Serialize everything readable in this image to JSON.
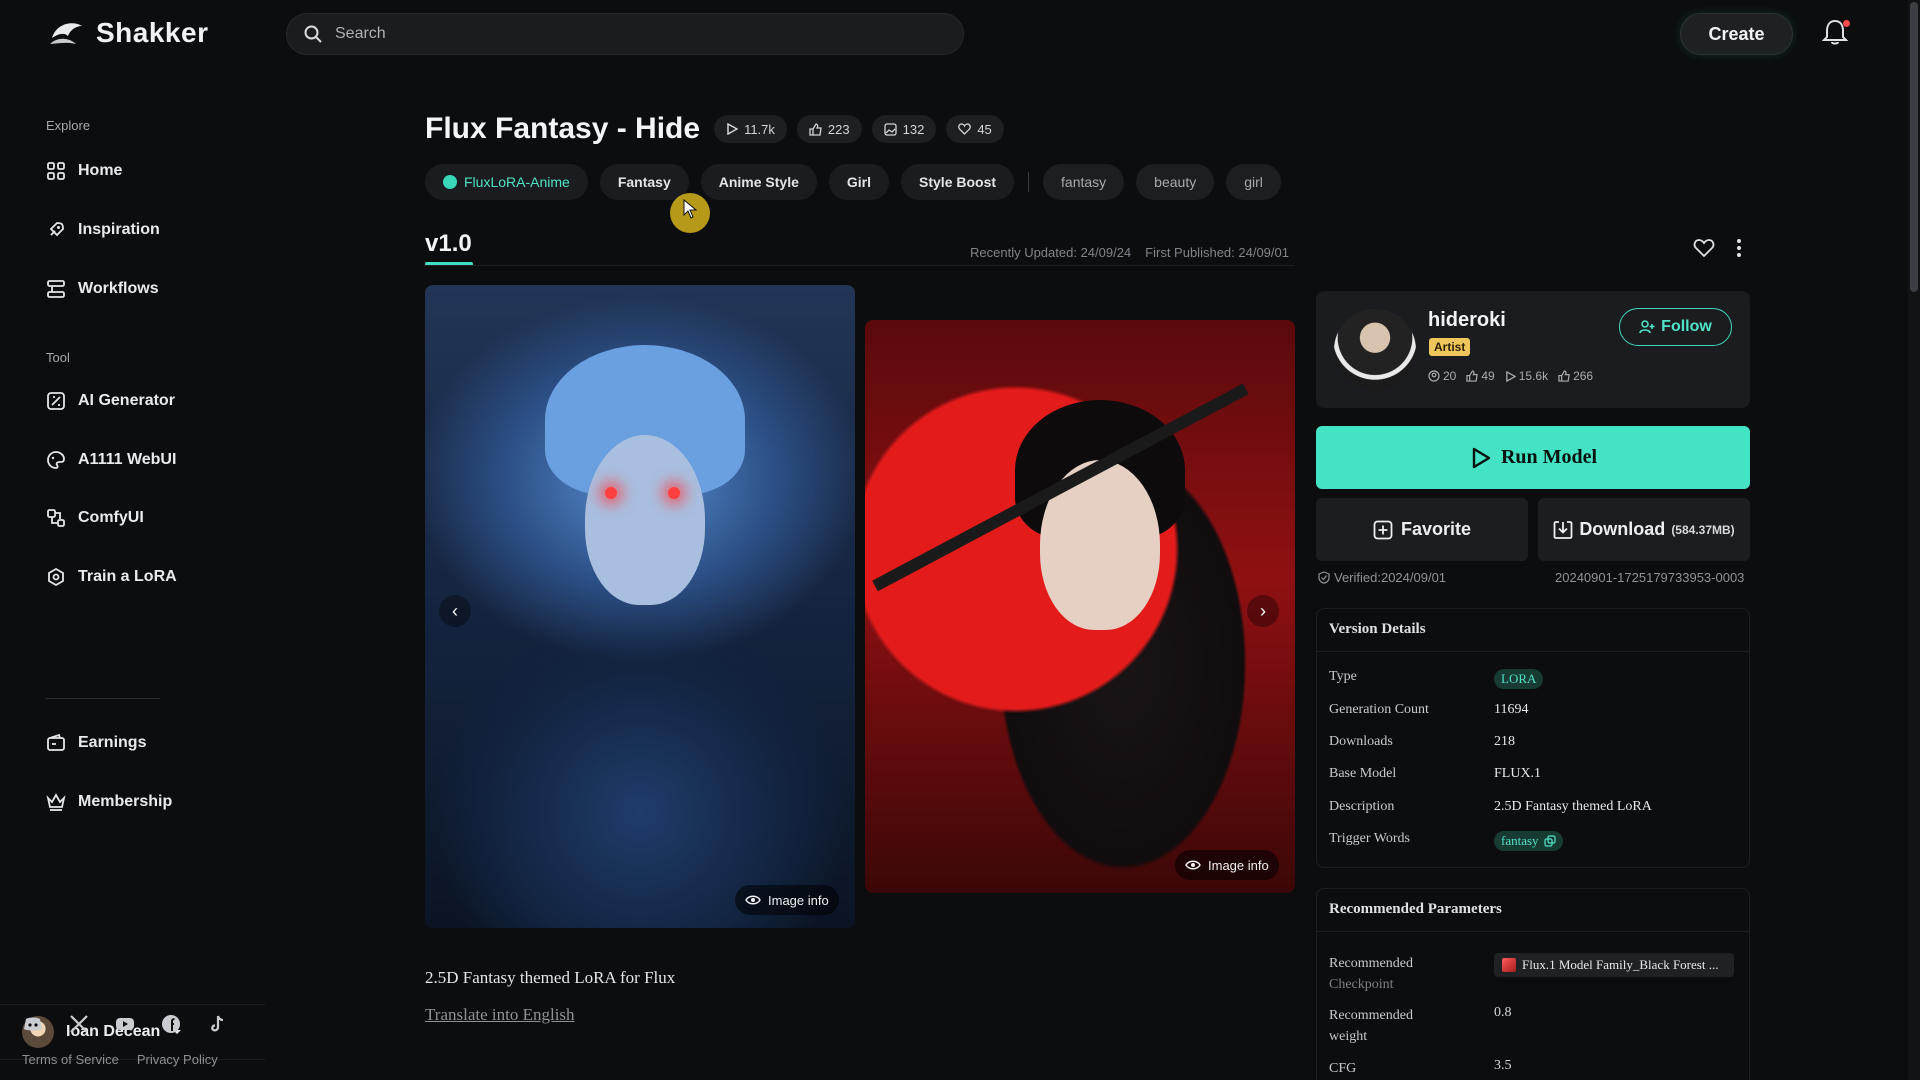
{
  "brand": {
    "name": "Shakker",
    "accent": "#44e3c6"
  },
  "search": {
    "placeholder": "Search"
  },
  "header": {
    "create_label": "Create",
    "icons": [
      "search-icon",
      "bell-icon"
    ]
  },
  "sidebar": {
    "explore_label": "Explore",
    "explore_items": [
      {
        "label": "Home",
        "icon": "home-icon"
      },
      {
        "label": "Inspiration",
        "icon": "rocket-icon"
      },
      {
        "label": "Workflows",
        "icon": "workflow-icon"
      }
    ],
    "tool_label": "Tool",
    "tool_items": [
      {
        "label": "AI Generator",
        "icon": "ai-generator-icon"
      },
      {
        "label": "A1111 WebUI",
        "icon": "palette-icon"
      },
      {
        "label": "ComfyUI",
        "icon": "comfy-icon"
      },
      {
        "label": "Train a LoRA",
        "icon": "train-icon"
      }
    ],
    "other_items": [
      {
        "label": "Earnings",
        "icon": "wallet-icon"
      },
      {
        "label": "Membership",
        "icon": "crown-icon"
      }
    ],
    "user": {
      "name": "Ioan Decean"
    },
    "socials": [
      "discord-icon",
      "x-icon",
      "youtube-icon",
      "facebook-icon",
      "tiktok-icon"
    ],
    "legal": {
      "terms": "Terms of Service",
      "privacy": "Privacy Policy"
    }
  },
  "model": {
    "title": "Flux Fantasy - Hide",
    "stats": {
      "runs": "11.7k",
      "likes": "223",
      "images": "132",
      "favorites": "45"
    },
    "tags": {
      "primary": "FluxLoRA-Anime",
      "main": [
        "Fantasy",
        "Anime Style",
        "Girl",
        "Style Boost"
      ],
      "muted": [
        "fantasy",
        "beauty",
        "girl"
      ]
    },
    "version": "v1.0",
    "recently_updated": "Recently Updated: 24/09/24",
    "first_published": "First Published: 24/09/01",
    "image_info_label": "Image info",
    "description": "2.5D Fantasy themed LoRA for Flux",
    "translate_label": "Translate into English"
  },
  "author": {
    "name": "hideroki",
    "badge": "Artist",
    "stats": {
      "followers": "20",
      "likes": "49",
      "runs": "15.6k",
      "downloads": "266"
    },
    "follow_label": "Follow"
  },
  "actions": {
    "run_label": "Run Model",
    "favorite_label": "Favorite",
    "download_label": "Download",
    "download_size": "(584.37MB)",
    "verified": "Verified:2024/09/01",
    "hash": "20240901-1725179733953-0003"
  },
  "version_details": {
    "title": "Version Details",
    "rows": [
      {
        "key": "Type",
        "value": "LORA"
      },
      {
        "key": "Generation Count",
        "value": "11694"
      },
      {
        "key": "Downloads",
        "value": "218"
      },
      {
        "key": "Base Model",
        "value": "FLUX.1"
      },
      {
        "key": "Description",
        "value": "2.5D Fantasy themed LoRA"
      },
      {
        "key": "Trigger Words",
        "value": "fantasy"
      }
    ]
  },
  "recommended_params": {
    "title": "Recommended Parameters",
    "checkpoint_key_line1": "Recommended",
    "checkpoint_key_line2": "Checkpoint",
    "checkpoint_value": "Flux.1 Model Family_Black Forest ...",
    "weight_key_line1": "Recommended",
    "weight_key_line2": "weight",
    "weight_value": "0.8",
    "cfg_key": "CFG",
    "cfg_value": "3.5"
  }
}
